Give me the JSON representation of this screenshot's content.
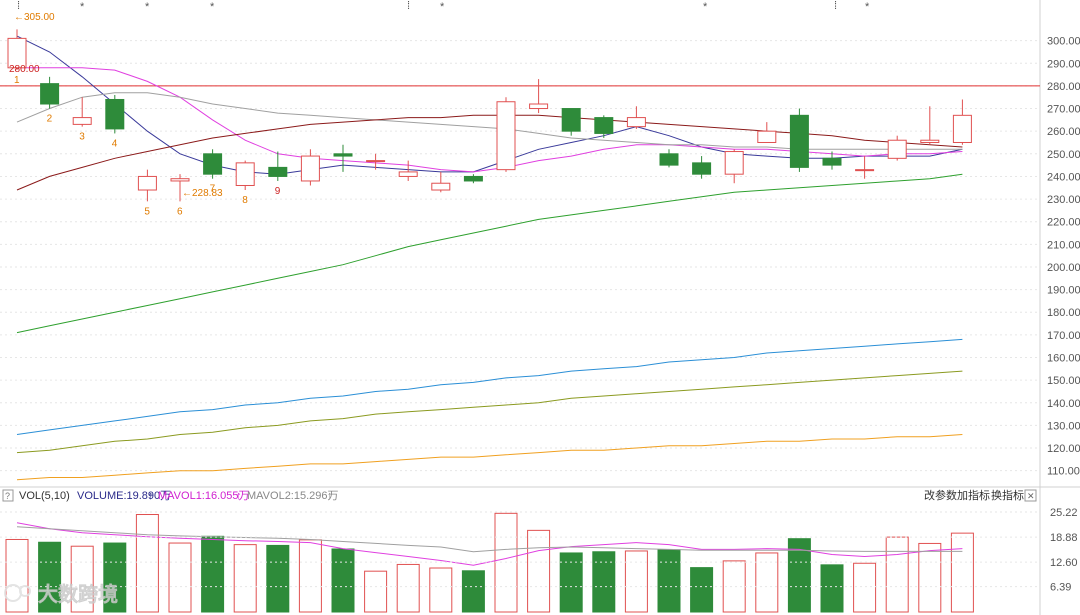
{
  "colors": {
    "up": "#e05050",
    "down": "#2e8b3a",
    "grid": "#e6e6e6",
    "ma5": "#3a3a9a",
    "ma10": "#e040e0",
    "ma20": "#a0a0a0",
    "ma60": "#8b1a1a",
    "ma120": "#2ea02e",
    "ma250": "#2b8fd6",
    "ma_olive": "#8b9a20",
    "ma_orange": "#f0a020",
    "resistance": "#e03030"
  },
  "price_axis": {
    "ticks": [
      "300.00",
      "290.00",
      "280.00",
      "270.00",
      "260.00",
      "250.00",
      "240.00",
      "230.00",
      "220.00",
      "210.00",
      "200.00",
      "190.00",
      "180.00",
      "170.00",
      "160.00",
      "150.00",
      "140.00",
      "130.00",
      "120.00",
      "110.00"
    ]
  },
  "volume_axis": {
    "ticks": [
      "25.22",
      "18.88",
      "12.60",
      "6.39"
    ]
  },
  "annotations": {
    "high": "305.00",
    "low": "228.83",
    "resistance": "280.00",
    "resistance_value": 280,
    "star": "*",
    "dash": "⁞"
  },
  "legend": {
    "help": "?",
    "indicator": "VOL(5,10)",
    "volume": "VOLUME:19.890万",
    "mavol1": "MAVOL1:16.055万",
    "mavol2": "MAVOL2:15.296万",
    "arrow": "↑"
  },
  "buttons": {
    "params": "改参数",
    "add": "加指标",
    "switch": "换指标",
    "close": "✕"
  },
  "watermark": "大数跨境",
  "chart_data": {
    "type": "candlestick",
    "price_ylim": [
      105,
      310
    ],
    "candles": [
      {
        "o": 288,
        "c": 301,
        "h": 305,
        "l": 287
      },
      {
        "o": 281,
        "c": 272,
        "h": 284,
        "l": 270
      },
      {
        "o": 263,
        "c": 266,
        "h": 275,
        "l": 262
      },
      {
        "o": 274,
        "c": 261,
        "h": 276,
        "l": 259
      },
      {
        "o": 234,
        "c": 240,
        "h": 243,
        "l": 229
      },
      {
        "o": 238,
        "c": 239,
        "h": 241,
        "l": 229
      },
      {
        "o": 250,
        "c": 241,
        "h": 252,
        "l": 239
      },
      {
        "o": 236,
        "c": 246,
        "h": 247,
        "l": 234
      },
      {
        "o": 244,
        "c": 240,
        "h": 251,
        "l": 238
      },
      {
        "o": 238,
        "c": 249,
        "h": 252,
        "l": 236
      },
      {
        "o": 250,
        "c": 249,
        "h": 254,
        "l": 242
      },
      {
        "o": 247,
        "c": 247,
        "h": 250,
        "l": 243
      },
      {
        "o": 240,
        "c": 242,
        "h": 247,
        "l": 238
      },
      {
        "o": 234,
        "c": 237,
        "h": 242,
        "l": 233
      },
      {
        "o": 240,
        "c": 238,
        "h": 241,
        "l": 237
      },
      {
        "o": 243,
        "c": 273,
        "h": 275,
        "l": 242
      },
      {
        "o": 270,
        "c": 272,
        "h": 283,
        "l": 268
      },
      {
        "o": 270,
        "c": 260,
        "h": 270,
        "l": 258
      },
      {
        "o": 266,
        "c": 259,
        "h": 267,
        "l": 257
      },
      {
        "o": 262,
        "c": 266,
        "h": 271,
        "l": 261
      },
      {
        "o": 250,
        "c": 245,
        "h": 252,
        "l": 244
      },
      {
        "o": 246,
        "c": 241,
        "h": 249,
        "l": 239
      },
      {
        "o": 241,
        "c": 251,
        "h": 252,
        "l": 237
      },
      {
        "o": 255,
        "c": 260,
        "h": 264,
        "l": 255
      },
      {
        "o": 267,
        "c": 244,
        "h": 270,
        "l": 242
      },
      {
        "o": 248,
        "c": 245,
        "h": 251,
        "l": 243
      },
      {
        "o": 243,
        "c": 243,
        "h": 249,
        "l": 239
      },
      {
        "o": 248,
        "c": 256,
        "h": 258,
        "l": 247
      },
      {
        "o": 255,
        "c": 256,
        "h": 271,
        "l": 254
      },
      {
        "o": 255,
        "c": 267,
        "h": 274,
        "l": 254
      }
    ],
    "candle_labels": [
      {
        "index": 0,
        "text": "1"
      },
      {
        "index": 1,
        "text": "2"
      },
      {
        "index": 2,
        "text": "3"
      },
      {
        "index": 3,
        "text": "4"
      },
      {
        "index": 4,
        "text": "5"
      },
      {
        "index": 5,
        "text": "6"
      },
      {
        "index": 6,
        "text": "7"
      },
      {
        "index": 7,
        "text": "8"
      },
      {
        "index": 8,
        "text": "9"
      }
    ],
    "ma_series": [
      {
        "color": "#3a3a9a",
        "values": [
          302,
          295,
          284,
          272,
          260,
          250,
          245,
          242,
          241,
          243,
          245,
          244,
          243,
          242,
          242,
          247,
          252,
          255,
          258,
          262,
          258,
          253,
          250,
          249,
          248,
          248,
          249,
          249,
          249,
          252
        ]
      },
      {
        "color": "#e040e0",
        "values": [
          288,
          288,
          288,
          287,
          282,
          275,
          265,
          256,
          250,
          248,
          247,
          246,
          245,
          243,
          242,
          244,
          247,
          249,
          252,
          254,
          254,
          253,
          252,
          252,
          251,
          250,
          249,
          250,
          250,
          251
        ]
      },
      {
        "color": "#a0a0a0",
        "values": [
          264,
          270,
          275,
          277,
          277,
          275,
          272,
          270,
          268,
          267,
          266,
          265,
          264,
          263,
          262,
          261,
          259,
          257,
          256,
          255,
          254,
          254,
          253,
          253,
          252,
          252,
          252,
          252,
          252,
          252
        ]
      },
      {
        "color": "#8b1a1a",
        "values": [
          234,
          240,
          244,
          248,
          251,
          254,
          257,
          259,
          261,
          263,
          264,
          265,
          266,
          266,
          267,
          267,
          267,
          266,
          265,
          264,
          263,
          262,
          261,
          260,
          259,
          258,
          256,
          255,
          254,
          253
        ]
      },
      {
        "color": "#2ea02e",
        "values": [
          171,
          174,
          177,
          180,
          183,
          186,
          189,
          192,
          195,
          198,
          201,
          205,
          209,
          212,
          215,
          218,
          221,
          223,
          225,
          227,
          229,
          231,
          233,
          234,
          235,
          236,
          237,
          238,
          239,
          241
        ]
      },
      {
        "color": "#2b8fd6",
        "values": [
          126,
          128,
          130,
          132,
          134,
          136,
          137,
          139,
          140,
          142,
          143,
          145,
          146,
          148,
          149,
          151,
          152,
          154,
          155,
          156,
          158,
          159,
          160,
          162,
          163,
          164,
          165,
          166,
          167,
          168
        ]
      },
      {
        "color": "#8b9a20",
        "values": [
          118,
          119,
          121,
          123,
          124,
          126,
          127,
          129,
          130,
          132,
          133,
          135,
          136,
          137,
          138,
          139,
          140,
          142,
          143,
          144,
          145,
          146,
          147,
          148,
          149,
          150,
          151,
          152,
          153,
          154
        ]
      },
      {
        "color": "#f0a020",
        "values": [
          106,
          107,
          107,
          108,
          109,
          110,
          110,
          111,
          112,
          113,
          113,
          114,
          115,
          116,
          116,
          117,
          118,
          119,
          119,
          120,
          121,
          121,
          122,
          123,
          123,
          124,
          124,
          125,
          125,
          126
        ]
      }
    ],
    "volume_ylim": [
      0,
      27
    ],
    "volumes": [
      18.3,
      17.6,
      16.6,
      17.4,
      24.6,
      17.4,
      19.1,
      17.0,
      16.8,
      18.2,
      15.9,
      10.3,
      12.0,
      11.1,
      10.4,
      24.9,
      20.6,
      14.9,
      15.2,
      15.4,
      15.7,
      11.2,
      12.9,
      14.9,
      18.5,
      11.9,
      12.3,
      18.9,
      17.3,
      19.9
    ],
    "mavol_series": [
      {
        "color": "#e040e0",
        "values": [
          22.5,
          21,
          20,
          19.5,
          19,
          18.6,
          18.3,
          18,
          17.8,
          17.5,
          16,
          15,
          14,
          13,
          11.8,
          13.5,
          15.5,
          16.5,
          17,
          17.5,
          17,
          15.8,
          15.8,
          16,
          15.8,
          14.5,
          14,
          14.5,
          15.5,
          16
        ]
      },
      {
        "color": "#a0a0a0",
        "values": [
          21.5,
          21,
          20.5,
          20,
          19.5,
          19.2,
          19,
          18.8,
          18.6,
          18.3,
          17.8,
          17.3,
          16.8,
          16.4,
          15.2,
          15.8,
          16.2,
          16.4,
          16.2,
          16,
          15.8,
          15.6,
          15.6,
          15.6,
          15.6,
          15.4,
          15.3,
          15.3,
          15.3,
          15.3
        ]
      }
    ]
  }
}
